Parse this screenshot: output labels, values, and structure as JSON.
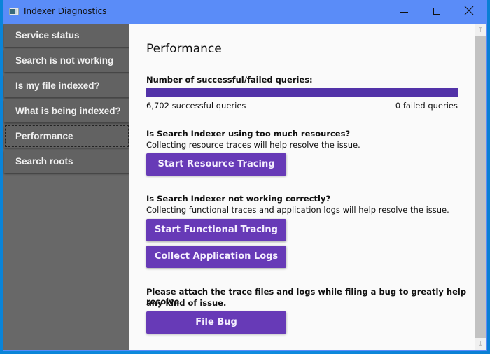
{
  "window": {
    "title": "Indexer Diagnostics",
    "controls": {
      "minimize_icon": "minimize-icon",
      "maximize_icon": "maximize-icon",
      "close_icon": "close-icon"
    }
  },
  "sidebar": {
    "items": [
      {
        "label": "Service status",
        "selected": false
      },
      {
        "label": "Search is not working",
        "selected": false
      },
      {
        "label": "Is my file indexed?",
        "selected": false
      },
      {
        "label": "What is being indexed?",
        "selected": false
      },
      {
        "label": "Performance",
        "selected": true
      },
      {
        "label": "Search roots",
        "selected": false
      }
    ]
  },
  "main": {
    "title": "Performance",
    "queries": {
      "heading": "Number of successful/failed queries:",
      "successful_count": 6702,
      "failed_count": 0,
      "success_fraction": 1.0,
      "successful_label": "6,702 successful queries",
      "failed_label": "0 failed queries"
    },
    "resources": {
      "heading": "Is Search Indexer using too much resources?",
      "description": "Collecting resource traces will help resolve the issue.",
      "button": "Start Resource Tracing"
    },
    "functional": {
      "heading": "Is Search Indexer not working correctly?",
      "description": "Collecting functional traces and application logs will help resolve the issue.",
      "button_tracing": "Start Functional Tracing",
      "button_logs": "Collect Application Logs"
    },
    "bug": {
      "heading_line1": "Please attach the trace files and logs while filing a bug to greatly help resolve",
      "heading_line2": "any kind of issue.",
      "button": "File Bug"
    }
  },
  "colors": {
    "titlebar": "#5a8cf8",
    "sidebar": "#686868",
    "nav_item": "#626262",
    "accent_button": "#673ab7",
    "progress_fill": "#5232a8",
    "content_bg": "#fafafa"
  },
  "scrollbar": {
    "up_icon": "arrow-up-icon",
    "down_icon": "arrow-down-icon"
  }
}
